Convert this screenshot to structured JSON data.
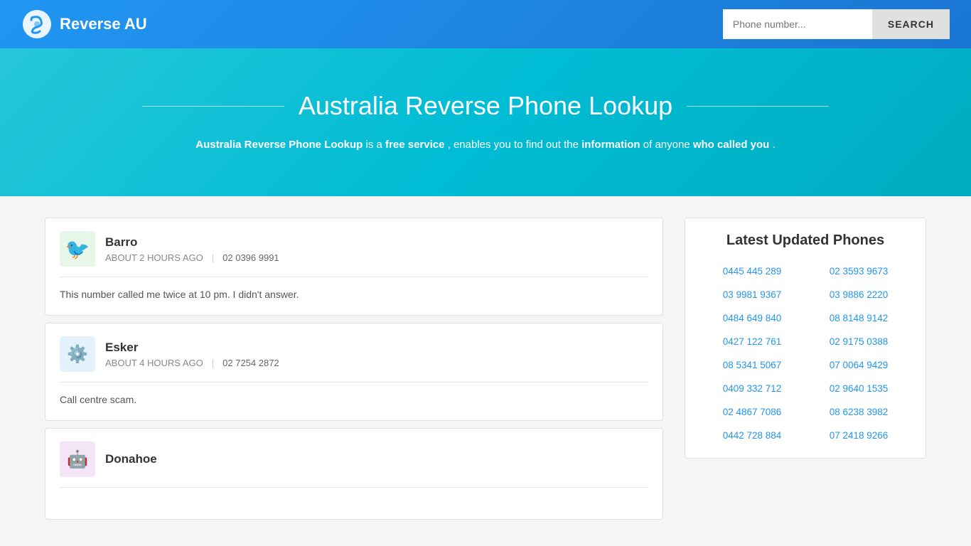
{
  "header": {
    "logo_text": "Reverse AU",
    "search_placeholder": "Phone number...",
    "search_button_label": "SEARCH"
  },
  "hero": {
    "title": "Australia Reverse Phone Lookup",
    "description_parts": [
      {
        "text": "Australia Reverse Phone Lookup",
        "bold": true
      },
      {
        "text": " is a ",
        "bold": false
      },
      {
        "text": "free service",
        "bold": true
      },
      {
        "text": ", enables you to find out the ",
        "bold": false
      },
      {
        "text": "information",
        "bold": true
      },
      {
        "text": " of anyone ",
        "bold": false
      },
      {
        "text": "who called you",
        "bold": true
      },
      {
        "text": ".",
        "bold": false
      }
    ]
  },
  "posts": [
    {
      "username": "Barro",
      "time": "ABOUT 2 HOURS AGO",
      "phone": "02 0396 9991",
      "body": "This number called me twice at 10 pm. I didn't answer.",
      "avatar_emoji": "🐦"
    },
    {
      "username": "Esker",
      "time": "ABOUT 4 HOURS AGO",
      "phone": "02 7254 2872",
      "body": "Call centre scam.",
      "avatar_emoji": "⚙️"
    },
    {
      "username": "Donahoe",
      "time": "",
      "phone": "",
      "body": "",
      "avatar_emoji": "🤖"
    }
  ],
  "sidebar": {
    "title": "Latest Updated Phones",
    "phones": [
      "0445 445 289",
      "02 3593 9673",
      "03 9981 9367",
      "03 9886 2220",
      "0484 649 840",
      "08 8148 9142",
      "0427 122 761",
      "02 9175 0388",
      "08 5341 5067",
      "07 0064 9429",
      "0409 332 712",
      "02 9640 1535",
      "02 4867 7086",
      "08 6238 3982",
      "0442 728 884",
      "07 2418 9266"
    ]
  }
}
